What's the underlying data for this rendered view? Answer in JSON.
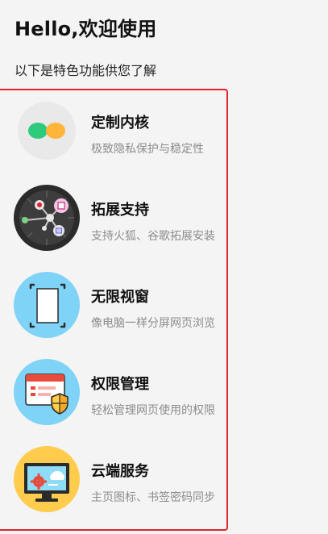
{
  "header": {
    "title": "Hello,欢迎使用",
    "subtitle": "以下是特色功能供您了解"
  },
  "features": [
    {
      "name": "定制内核",
      "desc": "极致隐私保护与稳定性",
      "icon": "kernel-dots-icon"
    },
    {
      "name": "拓展支持",
      "desc": "支持火狐、谷歌拓展安装",
      "icon": "extension-network-icon"
    },
    {
      "name": "无限视窗",
      "desc": "像电脑一样分屏网页浏览",
      "icon": "window-frame-icon"
    },
    {
      "name": "权限管理",
      "desc": "轻松管理网页使用的权限",
      "icon": "permission-shield-icon"
    },
    {
      "name": "云端服务",
      "desc": "主页图标、书签密码同步",
      "icon": "cloud-sync-icon"
    }
  ],
  "colors": {
    "panel_border": "#e0242c",
    "desc_text": "#8c8c8c",
    "icon_light_blue": "#7fd3f6",
    "icon_yellow": "#ffcc4d"
  }
}
